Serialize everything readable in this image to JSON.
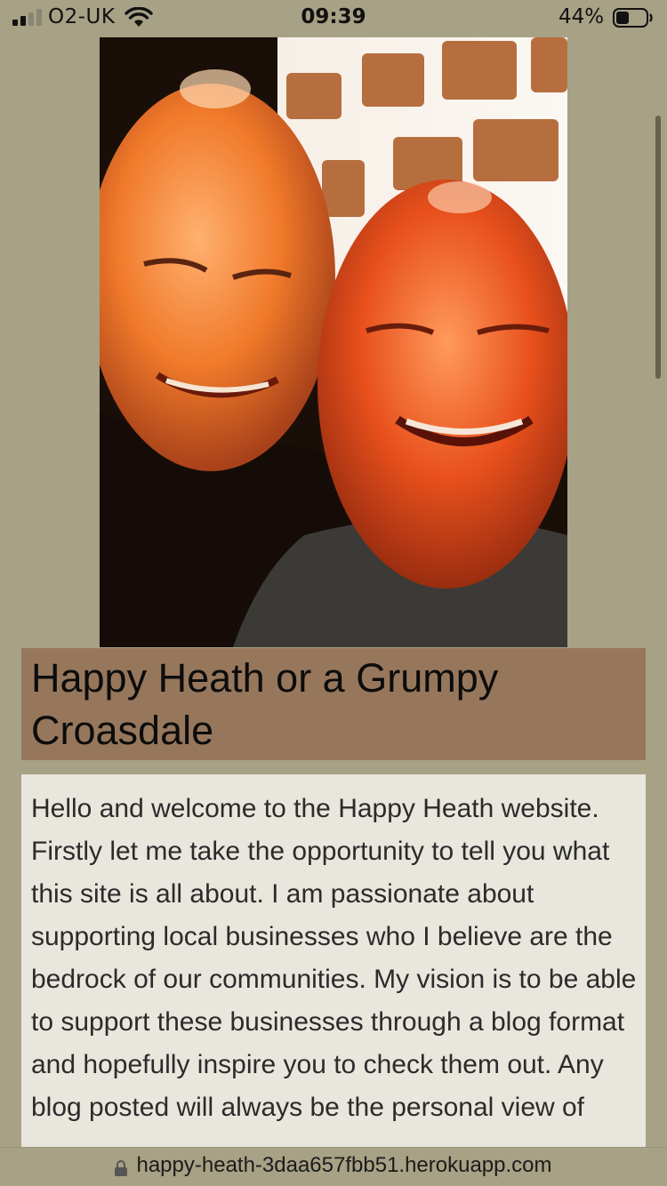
{
  "status_bar": {
    "carrier": "O2-UK",
    "time": "09:39",
    "battery_percent": "44%",
    "battery_level": 0.44,
    "signal_bars_active": 2,
    "signal_bars_total": 4,
    "icons": [
      "signal-icon",
      "wifi-icon",
      "battery-icon"
    ]
  },
  "hero": {
    "alt": "Two smiling bald men taking a selfie"
  },
  "site": {
    "title": "Happy Heath or a Grumpy Croasdale"
  },
  "intro": {
    "text": "Hello and welcome to the Happy Heath website. Firstly let me take the opportunity to tell you what this site is all about. I am passionate about supporting local businesses who I believe are the bedrock of our communities. My vision is to be able to support these businesses through a blog format and hopefully inspire you to check them out. Any blog posted will always be the personal view of"
  },
  "browser": {
    "url": "happy-heath-3daa657fbb51.herokuapp.com",
    "lock_icon": "lock-icon"
  },
  "colors": {
    "page_background": "#a7a185",
    "title_banner": "#97775c",
    "intro_background": "#e8e6dd"
  }
}
